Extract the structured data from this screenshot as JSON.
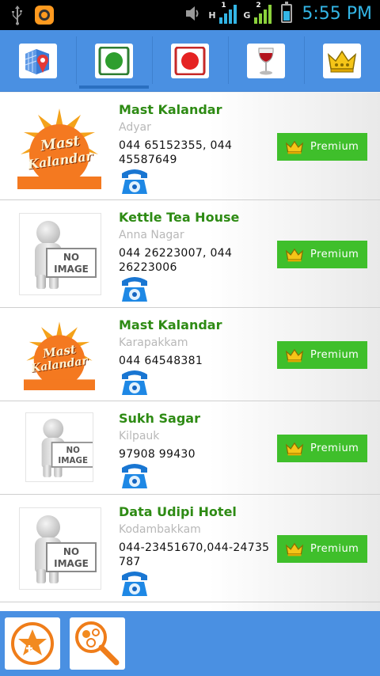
{
  "status_bar": {
    "time": "5:55 PM",
    "network_1": "H",
    "network_1_sup": "1",
    "network_2": "G",
    "network_2_sup": "2",
    "icons": [
      "usb-icon",
      "app-notification-icon",
      "volume-icon",
      "signal-icon",
      "battery-charging-icon"
    ]
  },
  "tabs": [
    {
      "id": "map",
      "icon": "map-pin-icon",
      "active": false
    },
    {
      "id": "veg",
      "icon": "green-dot-icon",
      "active": true
    },
    {
      "id": "nonveg",
      "icon": "red-dot-icon",
      "active": false
    },
    {
      "id": "bar",
      "icon": "wine-glass-icon",
      "active": false
    },
    {
      "id": "premium",
      "icon": "crown-icon",
      "active": false
    }
  ],
  "premium_label": "Premium",
  "restaurants": [
    {
      "name": "Mast Kalandar",
      "area": "Adyar",
      "phone": "044 65152355, 044 45587649",
      "image": "logo",
      "logo_text": [
        "Mast",
        "Kalandar"
      ]
    },
    {
      "name": "Kettle Tea House",
      "area": "Anna Nagar",
      "phone": "044  26223007, 044 26223006",
      "image": "none",
      "placeholder": [
        "NO",
        "IMAGE"
      ]
    },
    {
      "name": "Mast Kalandar",
      "area": "Karapakkam",
      "phone": "044 64548381",
      "image": "logo",
      "logo_text": [
        "Mast",
        "Kalandar"
      ]
    },
    {
      "name": "Sukh Sagar",
      "area": "Kilpauk",
      "phone": "97908 99430",
      "image": "none",
      "placeholder": [
        "NO",
        "IMAGE"
      ]
    },
    {
      "name": "Data Udipi Hotel",
      "area": "Kodambakkam",
      "phone": "044-23451670,044-24735787",
      "image": "none",
      "placeholder": [
        "NO",
        "IMAGE"
      ]
    }
  ],
  "bottom_bar": {
    "buttons": [
      {
        "id": "favorites-add",
        "icon": "star-add-icon"
      },
      {
        "id": "search-nearby",
        "icon": "magnifier-icon"
      }
    ]
  },
  "colors": {
    "header_blue": "#4a90e2",
    "name_green": "#2e8b14",
    "premium_green": "#3fbf2b",
    "status_blue": "#33b5e5"
  }
}
